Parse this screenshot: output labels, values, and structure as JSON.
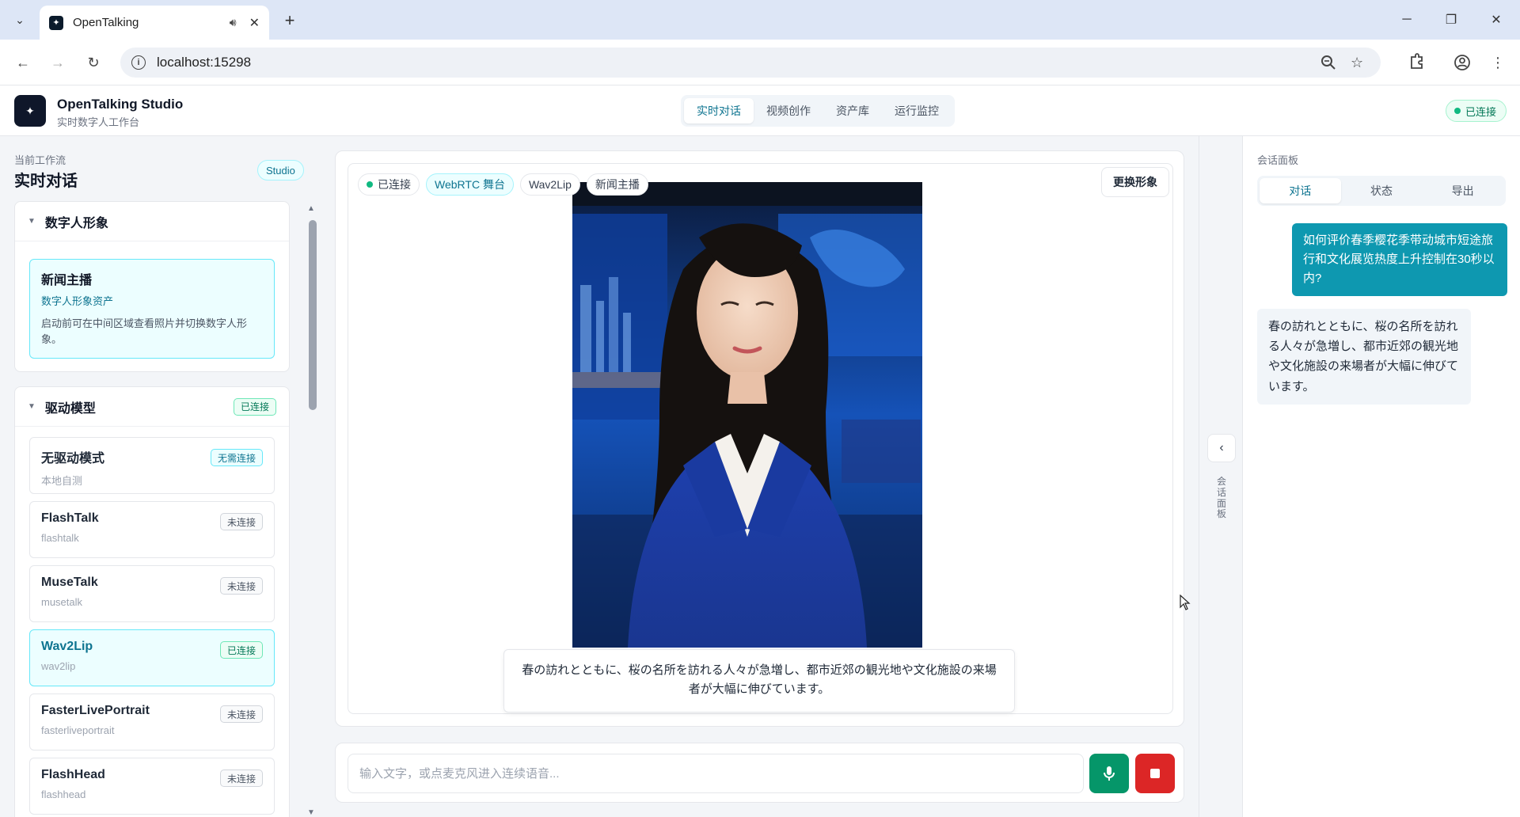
{
  "browser": {
    "tab_title": "OpenTalking",
    "url": "localhost:15298"
  },
  "app": {
    "title": "OpenTalking Studio",
    "subtitle": "实时数字人工作台",
    "nav": [
      "实时对话",
      "视频创作",
      "资产库",
      "运行监控"
    ],
    "active_nav": "实时对话",
    "status": "已连接"
  },
  "left": {
    "workflow_label": "当前工作流",
    "workflow_title": "实时对话",
    "studio_badge": "Studio",
    "avatar_section": {
      "title": "数字人形象",
      "card_title": "新闻主播",
      "card_sub": "数字人形象资产",
      "card_desc": "启动前可在中间区域查看照片并切换数字人形象。"
    },
    "model_section": {
      "title": "驱动模型",
      "badge": "已连接",
      "models": [
        {
          "name": "无驱动模式",
          "id": "本地自测",
          "status": "无需连接"
        },
        {
          "name": "FlashTalk",
          "id": "flashtalk",
          "status": "未连接"
        },
        {
          "name": "MuseTalk",
          "id": "musetalk",
          "status": "未连接"
        },
        {
          "name": "Wav2Lip",
          "id": "wav2lip",
          "status": "已连接"
        },
        {
          "name": "FasterLivePortrait",
          "id": "fasterliveportrait",
          "status": "未连接"
        },
        {
          "name": "FlashHead",
          "id": "flashhead",
          "status": "未连接"
        }
      ]
    }
  },
  "stage": {
    "chips": [
      "已连接",
      "WebRTC 舞台",
      "Wav2Lip",
      "新闻主播"
    ],
    "swap_button": "更换形象",
    "subtitle": "春の訪れとともに、桜の名所を訪れる人々が急増し、都市近郊の観光地や文化施設の来場者が大幅に伸びています。",
    "input_placeholder": "输入文字，或点麦克风进入连续语音..."
  },
  "collapse": {
    "label": "会话面板"
  },
  "right": {
    "label": "会话面板",
    "tabs": [
      "对话",
      "状态",
      "导出"
    ],
    "active_tab": "对话",
    "messages": [
      {
        "role": "user",
        "text": "如何评价春季樱花季带动城市短途旅行和文化展览热度上升控制在30秒以内?"
      },
      {
        "role": "assistant",
        "text": "春の訪れとともに、桜の名所を訪れる人々が急増し、都市近郊の観光地や文化施設の来場者が大幅に伸びています。"
      }
    ]
  }
}
